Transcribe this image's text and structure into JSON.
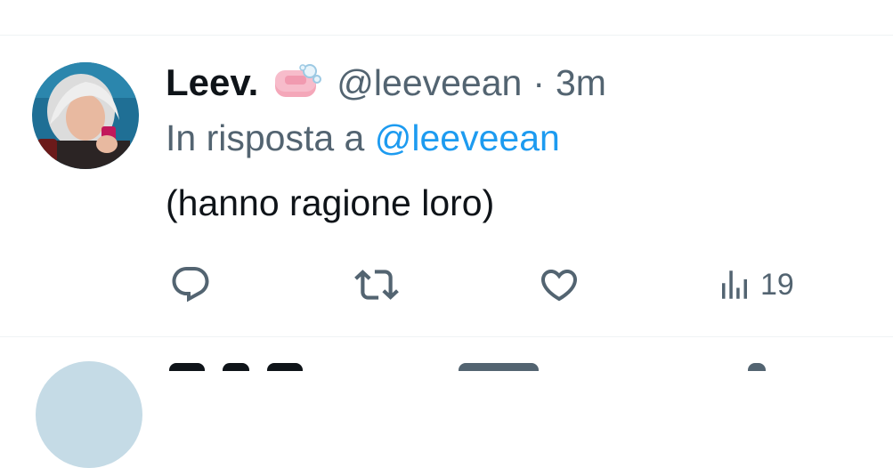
{
  "tweet": {
    "display_name": "Leev.",
    "name_emoji": "soap-emoji",
    "handle": "@leeveean",
    "separator": "·",
    "time": "3m",
    "reply_prefix": "In risposta a",
    "reply_to": "@leeveean",
    "text": "(hanno ragione loro)",
    "actions": {
      "reply_icon": "reply-icon",
      "retweet_icon": "retweet-icon",
      "like_icon": "heart-icon",
      "views_icon": "views-icon",
      "views_count": "19"
    }
  },
  "colors": {
    "text_primary": "#0f1419",
    "text_secondary": "#536471",
    "link": "#1d9bf0",
    "divider": "#eff3f4"
  }
}
